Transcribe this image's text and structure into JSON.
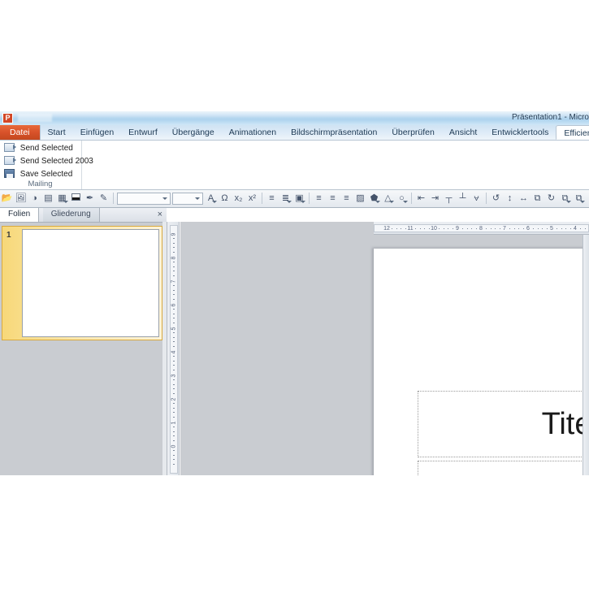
{
  "window": {
    "title": "Präsentation1 - Micro",
    "logo_letter": "P"
  },
  "ribbon": {
    "tabs": [
      {
        "label": "Datei",
        "kind": "file"
      },
      {
        "label": "Start",
        "kind": "normal"
      },
      {
        "label": "Einfügen",
        "kind": "normal"
      },
      {
        "label": "Entwurf",
        "kind": "normal"
      },
      {
        "label": "Übergänge",
        "kind": "normal"
      },
      {
        "label": "Animationen",
        "kind": "normal"
      },
      {
        "label": "Bildschirmpräsentation",
        "kind": "normal"
      },
      {
        "label": "Überprüfen",
        "kind": "normal"
      },
      {
        "label": "Ansicht",
        "kind": "normal"
      },
      {
        "label": "Entwicklertools",
        "kind": "normal"
      },
      {
        "label": "Efficienizers",
        "kind": "active"
      }
    ],
    "groups": [
      {
        "label": "Mailing",
        "items": [
          {
            "label": "Send Selected",
            "icon": "send-mail-icon"
          },
          {
            "label": "Send Selected 2003",
            "icon": "send-mail-icon"
          },
          {
            "label": "Save Selected",
            "icon": "save-disk-icon"
          }
        ]
      }
    ]
  },
  "toolbar": {
    "font_name": "",
    "font_name_placeholder": "",
    "font_size": "",
    "font_size_placeholder": "",
    "buttons": [
      {
        "name": "open-folder-icon",
        "glyph": "📂"
      },
      {
        "name": "insert-picture-icon",
        "glyph": "🖼"
      },
      {
        "name": "insert-object-icon",
        "glyph": "◑"
      },
      {
        "name": "text-box-icon",
        "glyph": "▤"
      },
      {
        "name": "table-icon",
        "glyph": "▦",
        "caret": true
      },
      {
        "name": "color-swatch-icon",
        "glyph": ""
      },
      {
        "name": "format-painter-icon",
        "glyph": "✒"
      },
      {
        "name": "undo-brush-icon",
        "glyph": "✎"
      }
    ],
    "buttons2": [
      {
        "name": "font-color-icon",
        "glyph": "A",
        "caret": true
      },
      {
        "name": "omega-symbol-icon",
        "glyph": "Ω"
      },
      {
        "name": "subscript-icon",
        "glyph": "x₂"
      },
      {
        "name": "superscript-icon",
        "glyph": "x²"
      },
      {
        "name": "bullet-list-icon",
        "glyph": "≡"
      },
      {
        "name": "numbered-list-icon",
        "glyph": "≣",
        "caret": true
      },
      {
        "name": "picture-frame-icon",
        "glyph": "▣",
        "caret": true
      },
      {
        "name": "align-left-icon",
        "glyph": "≡"
      },
      {
        "name": "align-center-icon",
        "glyph": "≡"
      },
      {
        "name": "align-right-icon",
        "glyph": "≡"
      },
      {
        "name": "insert-image-icon",
        "glyph": "▨"
      },
      {
        "name": "shape-fill-icon",
        "glyph": "⬟",
        "caret": true
      },
      {
        "name": "shape-outline-icon",
        "glyph": "△",
        "caret": true
      },
      {
        "name": "shape-effects-icon",
        "glyph": "○",
        "caret": true
      },
      {
        "name": "indent-decrease-icon",
        "glyph": "⇤"
      },
      {
        "name": "indent-increase-icon",
        "glyph": "⇥"
      },
      {
        "name": "align-top-icon",
        "glyph": "┬"
      },
      {
        "name": "align-bottom-icon",
        "glyph": "┴"
      },
      {
        "name": "distribute-h-icon",
        "glyph": "⩝"
      },
      {
        "name": "rotate-left-icon",
        "glyph": "↺"
      },
      {
        "name": "align-middle-icon",
        "glyph": "↕"
      },
      {
        "name": "distribute-v-icon",
        "glyph": "↔"
      },
      {
        "name": "group-objects-icon",
        "glyph": "⧉"
      },
      {
        "name": "rotate-icon",
        "glyph": "↻"
      },
      {
        "name": "duplicate-icon",
        "glyph": "⧉",
        "caret": true
      },
      {
        "name": "copy-style-icon",
        "glyph": "⧉",
        "caret": true
      },
      {
        "name": "more-tools-icon",
        "glyph": "◇"
      }
    ]
  },
  "slides_pane": {
    "tabs": [
      {
        "label": "Folien",
        "selected": true
      },
      {
        "label": "Gliederung",
        "selected": false
      }
    ],
    "close_label": "×",
    "slides": [
      {
        "number": "1",
        "selected": true
      }
    ]
  },
  "rulers": {
    "horizontal": [
      "12",
      "11",
      "10",
      "9",
      "8",
      "7",
      "6",
      "5",
      "4"
    ],
    "vertical": [
      "9",
      "8",
      "7",
      "6",
      "5",
      "4",
      "3",
      "2",
      "1",
      "0"
    ]
  },
  "slide": {
    "title_placeholder": "Titel durc",
    "subtitle_placeholder": ""
  }
}
